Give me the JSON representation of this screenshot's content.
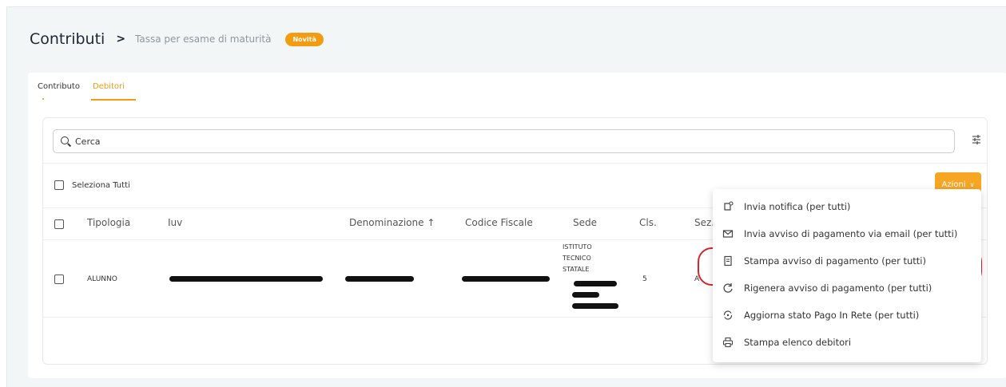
{
  "header": {
    "title": "Contributi",
    "breadcrumb": "Tassa per esame di maturità",
    "badge": "Novità"
  },
  "tabs": [
    {
      "label": "Contributo",
      "active": false
    },
    {
      "label": "Debitori",
      "active": true
    }
  ],
  "search": {
    "placeholder": "Cerca",
    "value": ""
  },
  "select_all_label": "Seleziona Tutti",
  "actions_button": "Azioni",
  "table": {
    "columns": [
      "Tipologia",
      "Iuv",
      "Denominazione ↑",
      "Codice Fiscale",
      "Sede",
      "Cls.",
      "Sez."
    ],
    "rows": [
      {
        "tipologia": "ALUNNO",
        "iuv": "",
        "denominazione": "",
        "codice_fiscale": "",
        "sede": [
          "ISTITUTO",
          "TECNICO",
          "STATALE"
        ],
        "cls": "5",
        "sez": "A"
      }
    ]
  },
  "actions_menu": {
    "items": [
      {
        "icon": "notification-bell-icon",
        "label": "Invia notifica (per tutti)"
      },
      {
        "icon": "mail-icon",
        "label": "Invia avviso di pagamento via email (per tutti)"
      },
      {
        "icon": "document-icon",
        "label": "Stampa avviso di pagamento (per tutti)"
      },
      {
        "icon": "refresh-icon",
        "label": "Rigenera avviso di pagamento (per tutti)"
      },
      {
        "icon": "sync-icon",
        "label": "Aggiorna stato Pago In Rete (per tutti)"
      },
      {
        "icon": "printer-icon",
        "label": "Stampa elenco debitori"
      }
    ]
  },
  "colors": {
    "accent": "#f39c12",
    "highlight": "#d6262d",
    "background": "#f2f6f7"
  }
}
